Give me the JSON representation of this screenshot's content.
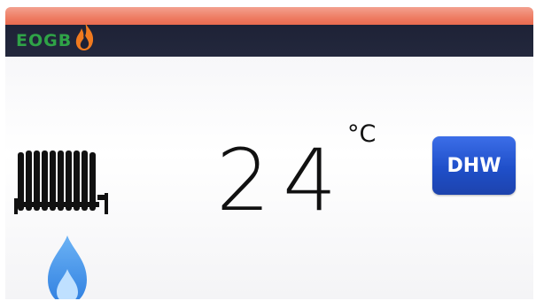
{
  "header": {
    "brand": "EOGB",
    "brand_color": "#2fa347",
    "flame_icon": "flame-icon",
    "accent_color": "#e96a4f"
  },
  "main": {
    "heating_icon": "radiator-icon",
    "temperature": "24",
    "unit": "°C",
    "dhw_button_label": "DHW",
    "dhw_button_color": "#1f4fc9",
    "burner_icon": "gas-flame-icon",
    "burner_color": "#3d8fe8"
  }
}
